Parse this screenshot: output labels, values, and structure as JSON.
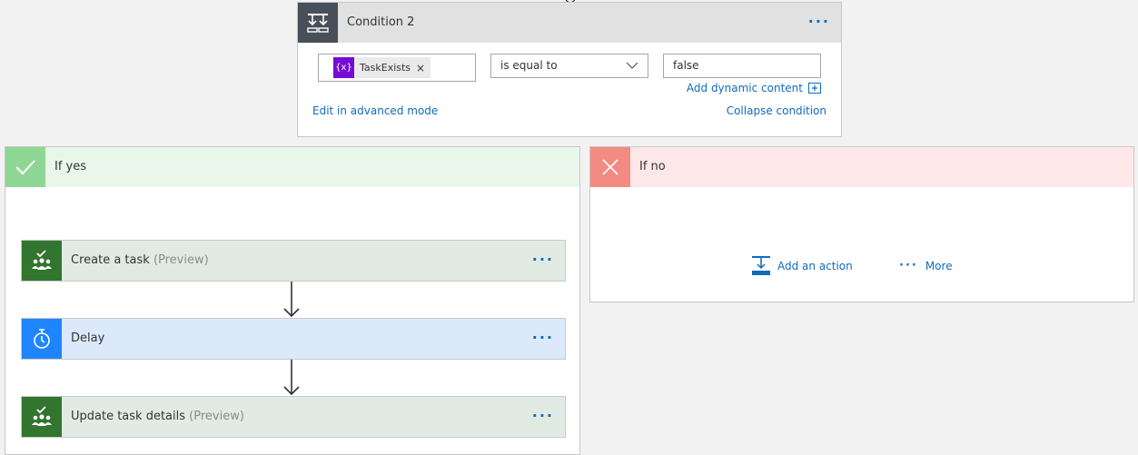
{
  "condition": {
    "title": "Condition 2",
    "more_label": "···",
    "operand": {
      "token_icon": "{x}",
      "token_label": "TaskExists",
      "remove_label": "×"
    },
    "operator": {
      "selected": "is equal to"
    },
    "value": "false",
    "add_dynamic_label": "Add dynamic content",
    "advanced_mode_label": "Edit in advanced mode",
    "collapse_label": "Collapse condition"
  },
  "yes_branch": {
    "title": "If yes",
    "actions": [
      {
        "label": "Create a task",
        "sub": "(Preview)",
        "more_label": "···",
        "icon": "planner-icon"
      },
      {
        "label": "Delay",
        "sub": "",
        "more_label": "···",
        "icon": "stopwatch-icon"
      },
      {
        "label": "Update task details",
        "sub": "(Preview)",
        "more_label": "···",
        "icon": "planner-icon"
      }
    ]
  },
  "no_branch": {
    "title": "If no",
    "add_action_label": "Add an action",
    "more_dots": "···",
    "more_label": "More"
  },
  "colors": {
    "accent_link": "#0f6cbd",
    "condition_icon_bg": "#484f58",
    "yes_icon_bg": "#8fd694",
    "no_icon_bg": "#f28b82",
    "planner_green": "#31752f",
    "delay_blue": "#1f85ff",
    "variable_purple": "#770bd6"
  }
}
